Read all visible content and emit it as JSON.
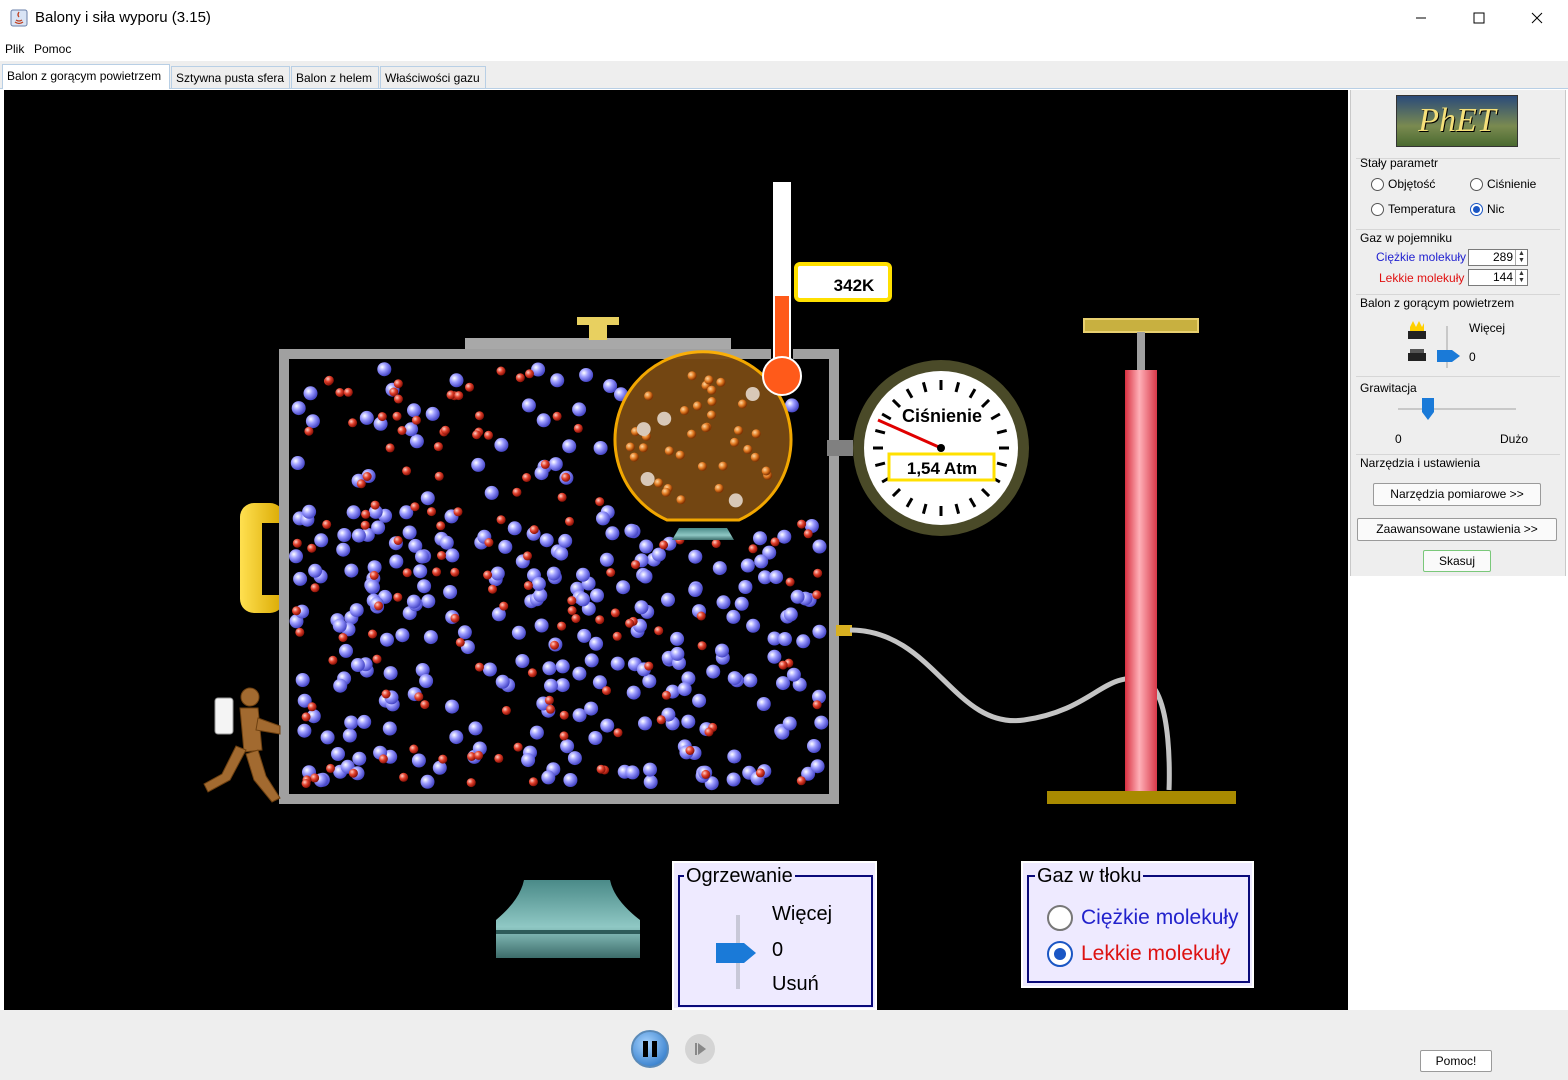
{
  "window": {
    "title": "Balony i siła wyporu (3.15)",
    "controls": [
      "minimize-icon",
      "maximize-icon",
      "close-icon"
    ]
  },
  "menu": {
    "items": [
      "Plik",
      "Pomoc"
    ]
  },
  "tabs": [
    {
      "label": "Balon z gorącym powietrzem",
      "active": true
    },
    {
      "label": "Sztywna pusta sfera",
      "active": false
    },
    {
      "label": "Balon z helem",
      "active": false
    },
    {
      "label": "Właściwości gazu",
      "active": false
    }
  ],
  "sim": {
    "thermometer": {
      "value": "342K"
    },
    "gauge": {
      "title": "Ciśnienie",
      "value": "1,54 Atm"
    },
    "heating": {
      "title": "Ogrzewanie",
      "more": "Więcej",
      "zero": "0",
      "remove": "Usuń"
    },
    "pump_gas": {
      "title": "Gaz w tłoku",
      "options": [
        {
          "label": "Ciężkie molekuły",
          "color": "#2222cc",
          "selected": false
        },
        {
          "label": "Lekkie molekuły",
          "color": "#dd1111",
          "selected": true
        }
      ]
    }
  },
  "panel": {
    "logo": "PhET",
    "const_param": {
      "title": "Stały parametr",
      "options": [
        {
          "label": "Objętość",
          "selected": false
        },
        {
          "label": "Ciśnienie",
          "selected": false
        },
        {
          "label": "Temperatura",
          "selected": false
        },
        {
          "label": "Nic",
          "selected": true
        }
      ]
    },
    "gas": {
      "title": "Gaz w pojemniku",
      "heavy_label": "Ciężkie molekuły",
      "heavy_value": "289",
      "light_label": "Lekkie molekuły",
      "light_value": "144"
    },
    "balloon": {
      "title": "Balon z gorącym powietrzem",
      "more": "Więcej",
      "zero": "0"
    },
    "gravity": {
      "title": "Grawitacja",
      "min": "0",
      "max": "Dużo"
    },
    "tools": {
      "title": "Narzędzia i ustawienia",
      "measure_button": "Narzędzia pomiarowe >>",
      "advanced_button": "Zaawansowane ustawienia >>",
      "reset_button": "Skasuj"
    }
  },
  "bottom": {
    "help_button": "Pomoc!"
  },
  "colors": {
    "heavy": "#9090ff",
    "light": "#e03a2a",
    "balloon": "#b86a14",
    "pump": "#ff7a8a",
    "gauge_frame": "#3a3a20"
  }
}
